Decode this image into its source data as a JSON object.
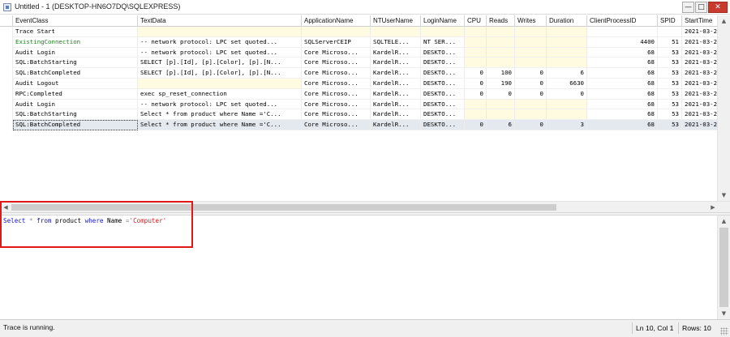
{
  "window": {
    "title": "Untitled - 1 (DESKTOP-HN6O7DQ\\SQLEXPRESS)",
    "minimize_glyph": "—",
    "maximize_glyph": "□",
    "close_glyph": "✕"
  },
  "grid": {
    "columns": [
      {
        "key": "EventClass",
        "label": "EventClass",
        "width": 154
      },
      {
        "key": "TextData",
        "label": "TextData",
        "width": 202
      },
      {
        "key": "ApplicationName",
        "label": "ApplicationName",
        "width": 85
      },
      {
        "key": "NTUserName",
        "label": "NTUserName",
        "width": 62
      },
      {
        "key": "LoginName",
        "label": "LoginName",
        "width": 54
      },
      {
        "key": "CPU",
        "label": "CPU",
        "width": 27
      },
      {
        "key": "Reads",
        "label": "Reads",
        "width": 35
      },
      {
        "key": "Writes",
        "label": "Writes",
        "width": 39
      },
      {
        "key": "Duration",
        "label": "Duration",
        "width": 50
      },
      {
        "key": "ClientProcessID",
        "label": "ClientProcessID",
        "width": 87
      },
      {
        "key": "SPID",
        "label": "SPID",
        "width": 30
      },
      {
        "key": "StartTime",
        "label": "StartTime",
        "width": 110
      }
    ],
    "rows": [
      {
        "EventClass": "Trace Start",
        "TextData": "",
        "ApplicationName": "",
        "NTUserName": "",
        "LoginName": "",
        "CPU": "",
        "Reads": "",
        "Writes": "",
        "Duration": "",
        "ClientProcessID": "",
        "SPID": "",
        "StartTime": "2021-03-2"
      },
      {
        "EventClass": "ExistingConnection",
        "TextData": "-- network protocol: LPC  set quoted...",
        "ApplicationName": "SQLServerCEIP",
        "NTUserName": "SQLTELE...",
        "LoginName": "NT SER...",
        "CPU": "",
        "Reads": "",
        "Writes": "",
        "Duration": "",
        "ClientProcessID": "4400",
        "SPID": "51",
        "StartTime": "2021-03-2",
        "style": "green"
      },
      {
        "EventClass": "Audit Login",
        "TextData": "-- network protocol: LPC  set quoted...",
        "ApplicationName": "Core Microso...",
        "NTUserName": "KardelR...",
        "LoginName": "DESKTO...",
        "CPU": "",
        "Reads": "",
        "Writes": "",
        "Duration": "",
        "ClientProcessID": "68",
        "SPID": "53",
        "StartTime": "2021-03-2"
      },
      {
        "EventClass": "SQL:BatchStarting",
        "TextData": "SELECT [p].[Id], [p].[Color], [p].[N...",
        "ApplicationName": "Core Microso...",
        "NTUserName": "KardelR...",
        "LoginName": "DESKTO...",
        "CPU": "",
        "Reads": "",
        "Writes": "",
        "Duration": "",
        "ClientProcessID": "68",
        "SPID": "53",
        "StartTime": "2021-03-2"
      },
      {
        "EventClass": "SQL:BatchCompleted",
        "TextData": "SELECT [p].[Id], [p].[Color], [p].[N...",
        "ApplicationName": "Core Microso...",
        "NTUserName": "KardelR...",
        "LoginName": "DESKTO...",
        "CPU": "0",
        "Reads": "100",
        "Writes": "0",
        "Duration": "6",
        "ClientProcessID": "68",
        "SPID": "53",
        "StartTime": "2021-03-2"
      },
      {
        "EventClass": "Audit Logout",
        "TextData": "",
        "ApplicationName": "Core Microso...",
        "NTUserName": "KardelR...",
        "LoginName": "DESKTO...",
        "CPU": "0",
        "Reads": "190",
        "Writes": "0",
        "Duration": "6630",
        "ClientProcessID": "68",
        "SPID": "53",
        "StartTime": "2021-03-2"
      },
      {
        "EventClass": "RPC:Completed",
        "TextData": "exec sp_reset_connection",
        "ApplicationName": "Core Microso...",
        "NTUserName": "KardelR...",
        "LoginName": "DESKTO...",
        "CPU": "0",
        "Reads": "0",
        "Writes": "0",
        "Duration": "0",
        "ClientProcessID": "68",
        "SPID": "53",
        "StartTime": "2021-03-2"
      },
      {
        "EventClass": "Audit Login",
        "TextData": "-- network protocol: LPC  set quoted...",
        "ApplicationName": "Core Microso...",
        "NTUserName": "KardelR...",
        "LoginName": "DESKTO...",
        "CPU": "",
        "Reads": "",
        "Writes": "",
        "Duration": "",
        "ClientProcessID": "68",
        "SPID": "53",
        "StartTime": "2021-03-2"
      },
      {
        "EventClass": "SQL:BatchStarting",
        "TextData": "Select * from product where Name ='C...",
        "ApplicationName": "Core Microso...",
        "NTUserName": "KardelR...",
        "LoginName": "DESKTO...",
        "CPU": "",
        "Reads": "",
        "Writes": "",
        "Duration": "",
        "ClientProcessID": "68",
        "SPID": "53",
        "StartTime": "2021-03-2"
      },
      {
        "EventClass": "SQL:BatchCompleted",
        "TextData": "Select * from product where Name ='C...",
        "ApplicationName": "Core Microso...",
        "NTUserName": "KardelR...",
        "LoginName": "DESKTO...",
        "CPU": "0",
        "Reads": "6",
        "Writes": "0",
        "Duration": "3",
        "ClientProcessID": "68",
        "SPID": "53",
        "StartTime": "2021-03-2",
        "style": "selected"
      }
    ],
    "numeric_columns": [
      "CPU",
      "Reads",
      "Writes",
      "Duration",
      "ClientProcessID",
      "SPID"
    ]
  },
  "textpane": {
    "tokens": [
      {
        "text": "Select",
        "style": "kw"
      },
      {
        "text": " ",
        "style": ""
      },
      {
        "text": "*",
        "style": "op"
      },
      {
        "text": " ",
        "style": ""
      },
      {
        "text": "from",
        "style": "kw"
      },
      {
        "text": " product ",
        "style": ""
      },
      {
        "text": "where",
        "style": "kw"
      },
      {
        "text": " Name ",
        "style": ""
      },
      {
        "text": "=",
        "style": "op"
      },
      {
        "text": "'Computer'",
        "style": "str"
      }
    ]
  },
  "statusbar": {
    "message": "Trace is running.",
    "position": "Ln 10, Col 1",
    "rows": "Rows: 10"
  },
  "icons": {
    "up": "▲",
    "down": "▼",
    "left": "◀",
    "right": "▶"
  },
  "colors": {
    "highlight_box": "#e21818",
    "empty_cell": "#fffbe1",
    "selected_row": "#e4e8ef",
    "existing_connection_text": "#1a7f1a",
    "sql_keyword": "#1212d6",
    "sql_string": "#d11a1a"
  }
}
